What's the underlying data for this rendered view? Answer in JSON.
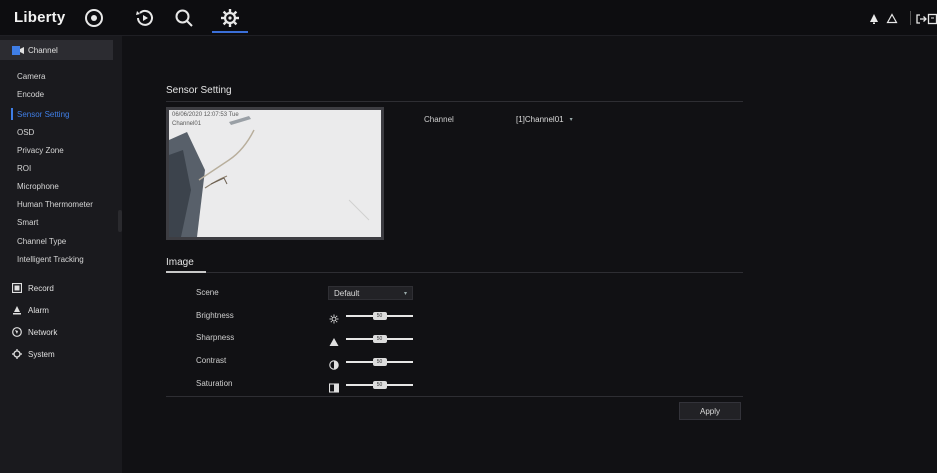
{
  "app": {
    "logo": "Liberty"
  },
  "topnav": {
    "items": [
      {
        "name": "live-view",
        "icon": "live-view-icon"
      },
      {
        "name": "playback",
        "icon": "playback-icon"
      },
      {
        "name": "search",
        "icon": "search-icon"
      },
      {
        "name": "settings",
        "icon": "gear-icon",
        "active": true
      }
    ],
    "right_icons": [
      "alarm-bell-icon",
      "notification-icon",
      "logout-icon",
      "fullscreen-icon"
    ]
  },
  "sidebar": {
    "header": "Channel",
    "items": [
      {
        "label": "Camera"
      },
      {
        "label": "Encode"
      },
      {
        "label": "Sensor Setting",
        "active": true
      },
      {
        "label": "OSD"
      },
      {
        "label": "Privacy Zone"
      },
      {
        "label": "ROI"
      },
      {
        "label": "Microphone"
      },
      {
        "label": "Human Thermometer"
      },
      {
        "label": "Smart"
      },
      {
        "label": "Channel Type"
      },
      {
        "label": "Intelligent Tracking"
      }
    ],
    "sections": [
      {
        "label": "Record",
        "icon": "record-icon"
      },
      {
        "label": "Alarm",
        "icon": "alarm-icon"
      },
      {
        "label": "Network",
        "icon": "network-icon"
      },
      {
        "label": "System",
        "icon": "system-gear-icon"
      }
    ]
  },
  "main": {
    "title": "Sensor Setting",
    "preview": {
      "osd_datetime": "06/06/2020 12:07:53 Tue",
      "osd_channel": "Channel01"
    },
    "channel": {
      "label": "Channel",
      "value": "[1]Channel01"
    },
    "image_section": "Image",
    "scene": {
      "label": "Scene",
      "value": "Default"
    },
    "sliders": [
      {
        "label": "Brightness",
        "icon": "brightness-icon",
        "value": 50
      },
      {
        "label": "Sharpness",
        "icon": "sharpness-icon",
        "value": 50
      },
      {
        "label": "Contrast",
        "icon": "contrast-icon",
        "value": 50
      },
      {
        "label": "Saturation",
        "icon": "saturation-icon",
        "value": 50
      }
    ],
    "apply_label": "Apply"
  },
  "colors": {
    "accent": "#3f7ee6",
    "background": "#111114",
    "sidebar": "#1a1a1e"
  }
}
